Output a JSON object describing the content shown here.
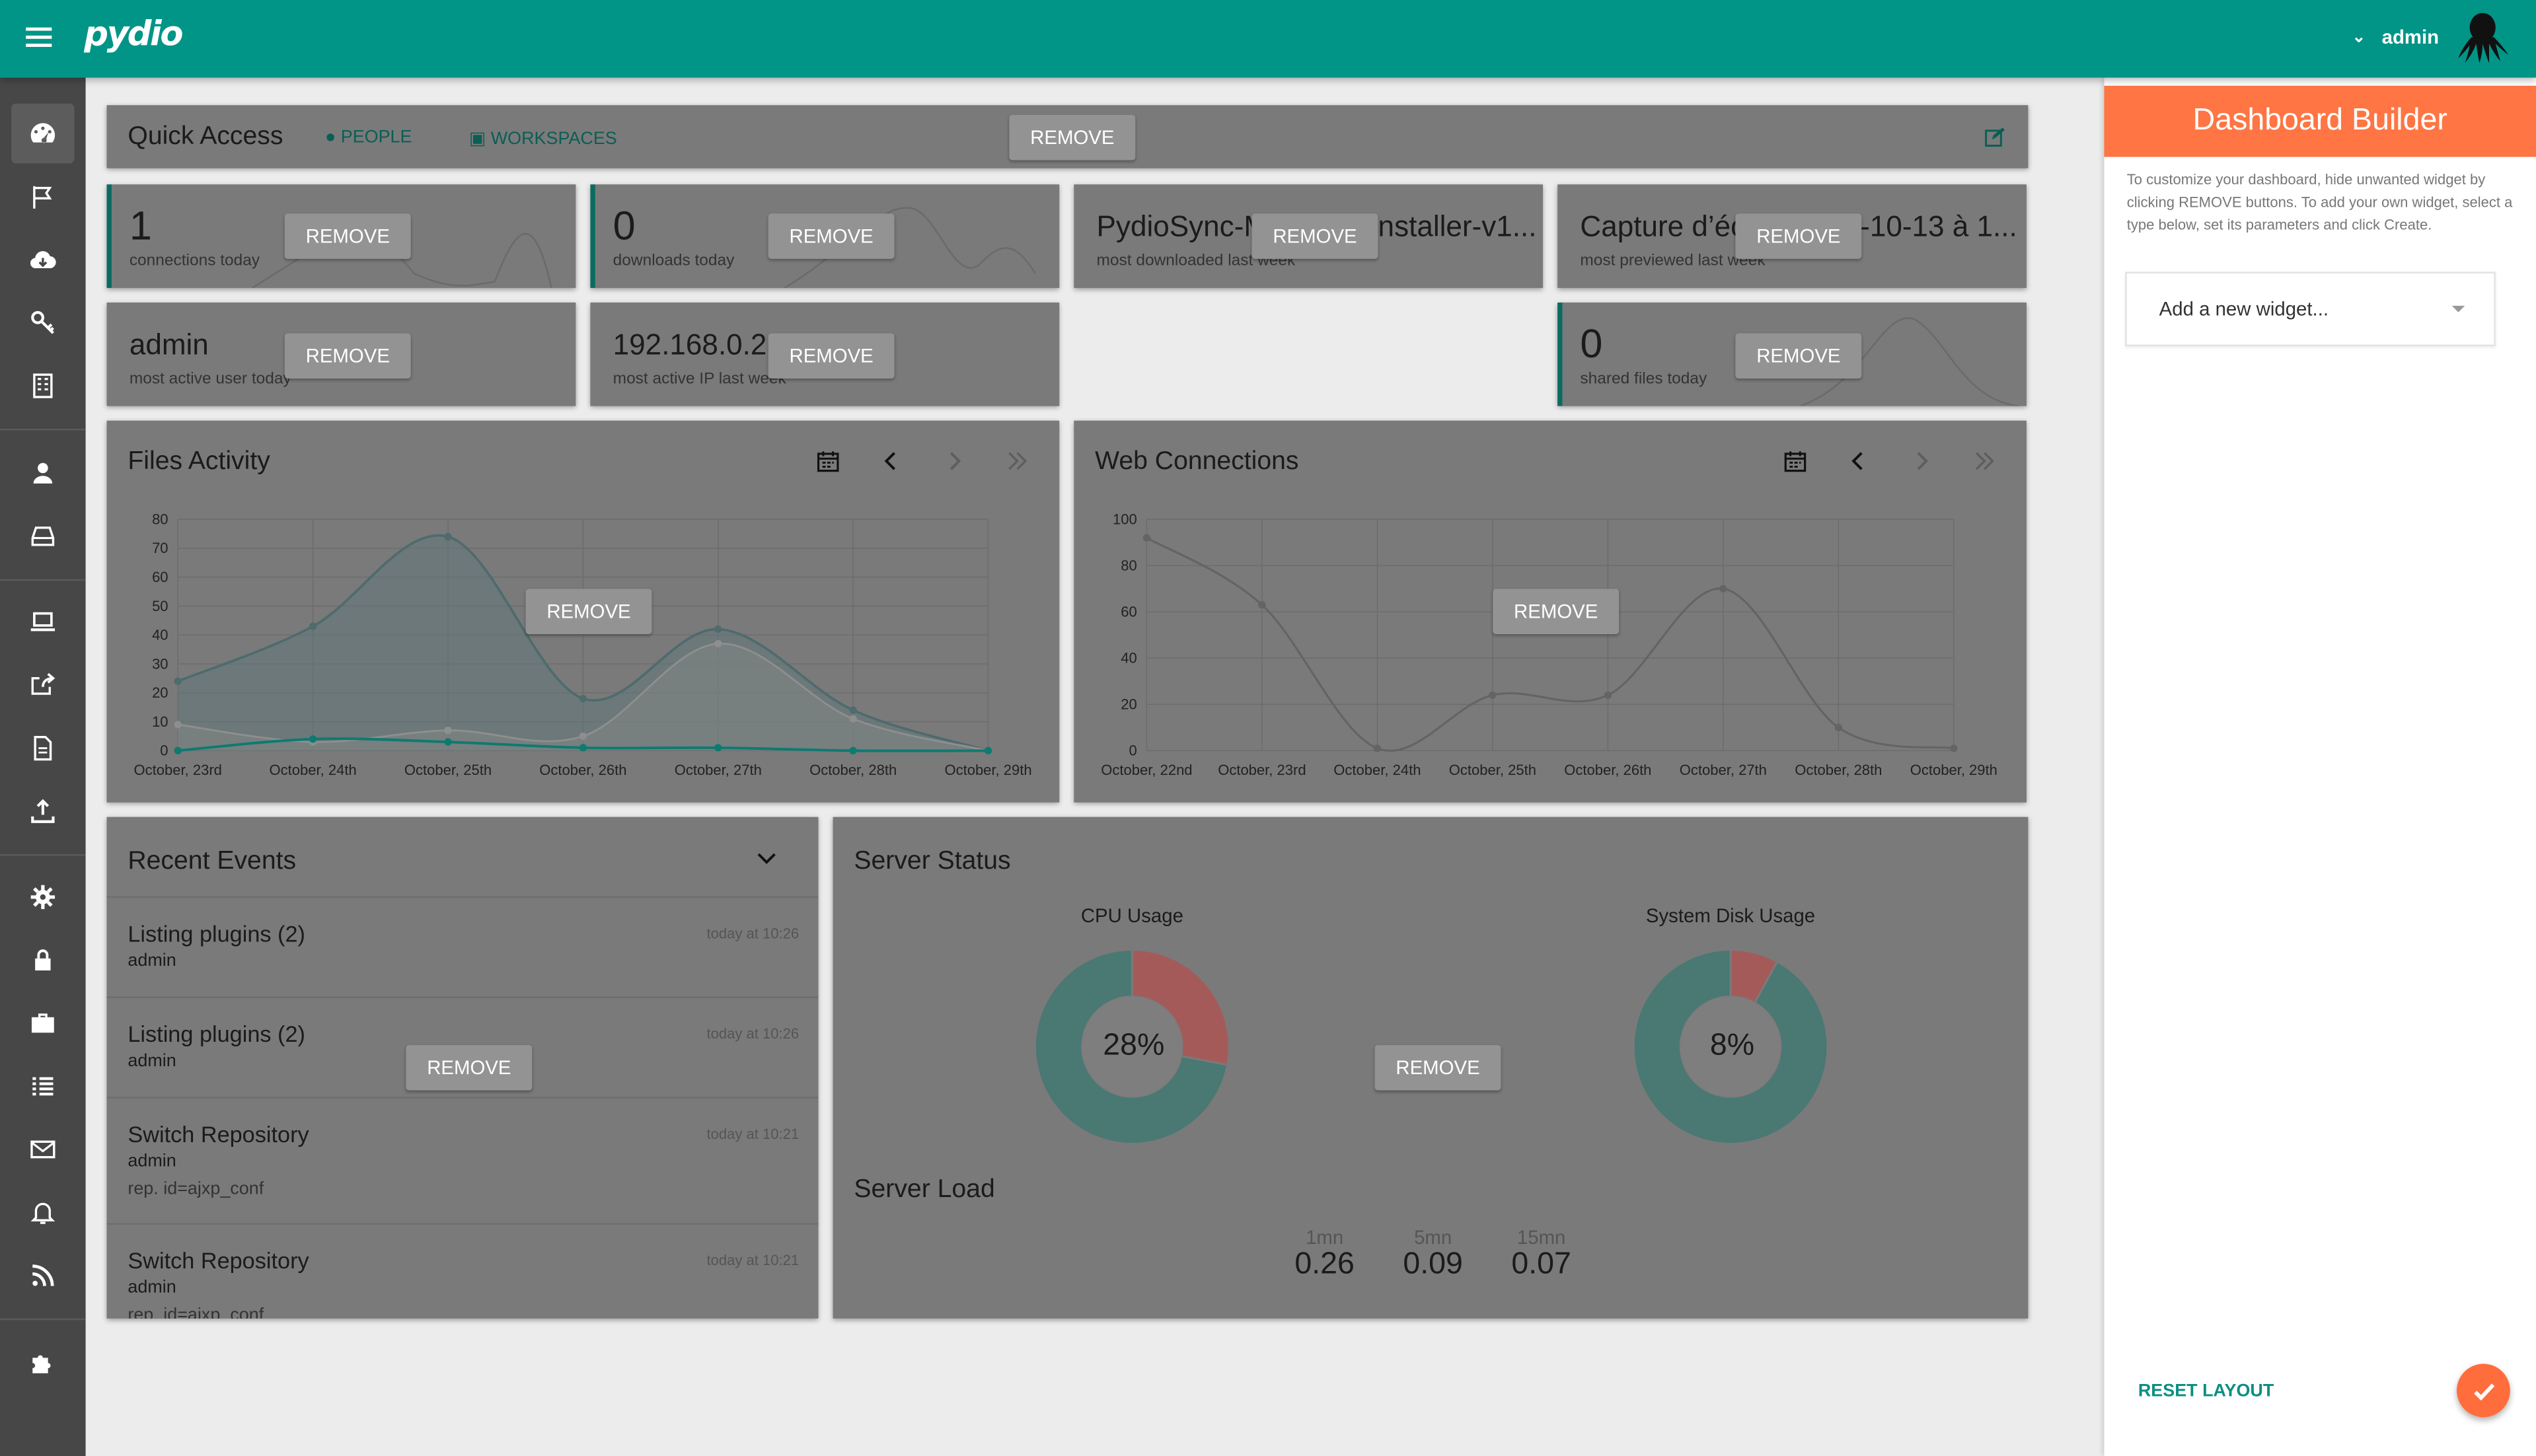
{
  "topbar": {
    "logo": "pydio",
    "username": "admin"
  },
  "sidebar": {
    "items": [
      {
        "icon": "dashboard-icon"
      },
      {
        "icon": "flag-icon"
      },
      {
        "icon": "cloud-download-icon"
      },
      {
        "icon": "key-icon"
      },
      {
        "icon": "building-icon"
      },
      {
        "icon": "user-icon"
      },
      {
        "icon": "drive-icon"
      },
      {
        "icon": "laptop-icon"
      },
      {
        "icon": "share-icon"
      },
      {
        "icon": "file-icon"
      },
      {
        "icon": "upload-icon"
      },
      {
        "icon": "gear-icon"
      },
      {
        "icon": "lock-icon"
      },
      {
        "icon": "briefcase-icon"
      },
      {
        "icon": "list-icon"
      },
      {
        "icon": "mail-icon"
      },
      {
        "icon": "bell-icon"
      },
      {
        "icon": "rss-icon"
      },
      {
        "icon": "puzzle-icon"
      }
    ]
  },
  "remove_label": "REMOVE",
  "quick_access": {
    "title": "Quick Access",
    "people": "PEOPLE",
    "workspaces": "WORKSPACES"
  },
  "stats": [
    {
      "value": "1",
      "label": "connections today"
    },
    {
      "value": "0",
      "label": "downloads today"
    },
    {
      "value": "PydioSync-MacOSX-Installer-v1...",
      "label": "most downloaded last week"
    },
    {
      "value": "Capture d’écran 2015-10-13 à 1...",
      "label": "most previewed last week"
    },
    {
      "value": "admin",
      "label": "most active user today"
    },
    {
      "value": "192.168.0.254",
      "label": "most active IP last week"
    },
    {
      "value": "0",
      "label": "shared files today"
    }
  ],
  "files_activity": {
    "title": "Files Activity"
  },
  "web_connections": {
    "title": "Web Connections"
  },
  "chart_data": [
    {
      "type": "area",
      "title": "Files Activity",
      "categories": [
        "October, 23rd",
        "October, 24th",
        "October, 25th",
        "October, 26th",
        "October, 27th",
        "October, 28th",
        "October, 29th"
      ],
      "ylim": [
        0,
        80
      ],
      "yticks": [
        0,
        10,
        20,
        30,
        40,
        50,
        60,
        70,
        80
      ],
      "series": [
        {
          "values": [
            24,
            43,
            74,
            18,
            42,
            14,
            0
          ]
        },
        {
          "values": [
            9,
            3,
            7,
            5,
            37,
            11,
            0
          ]
        },
        {
          "values": [
            0,
            4,
            3,
            1,
            1,
            0,
            0
          ]
        }
      ],
      "grid": true
    },
    {
      "type": "line",
      "title": "Web Connections",
      "categories": [
        "October, 22nd",
        "October, 23rd",
        "October, 24th",
        "October, 25th",
        "October, 26th",
        "October, 27th",
        "October, 28th",
        "October, 29th"
      ],
      "ylim": [
        0,
        100
      ],
      "yticks": [
        0,
        20,
        40,
        60,
        80,
        100
      ],
      "series": [
        {
          "values": [
            92,
            63,
            1,
            24,
            24,
            70,
            10,
            1
          ]
        }
      ],
      "grid": true
    },
    {
      "type": "pie",
      "title": "CPU Usage",
      "center_label": "28%",
      "values": [
        28,
        72
      ]
    },
    {
      "type": "pie",
      "title": "System Disk Usage",
      "center_label": "8%",
      "values": [
        8,
        92
      ]
    }
  ],
  "recent_events": {
    "title": "Recent Events",
    "items": [
      {
        "title": "Listing plugins (2)",
        "user": "admin",
        "extra": "",
        "time": "today at 10:26"
      },
      {
        "title": "Listing plugins (2)",
        "user": "admin",
        "extra": "",
        "time": "today at 10:26"
      },
      {
        "title": "Switch Repository",
        "user": "admin",
        "extra": "rep. id=ajxp_conf",
        "time": "today at 10:21"
      },
      {
        "title": "Switch Repository",
        "user": "admin",
        "extra": "rep. id=ajxp_conf",
        "time": "today at 10:21"
      }
    ]
  },
  "server_status": {
    "title": "Server Status",
    "cpu_label": "CPU Usage",
    "cpu_value": "28%",
    "disk_label": "System Disk Usage",
    "disk_value": "8%",
    "load_title": "Server Load",
    "loads": [
      {
        "label": "1mn",
        "value": "0.26"
      },
      {
        "label": "5mn",
        "value": "0.09"
      },
      {
        "label": "15mn",
        "value": "0.07"
      }
    ]
  },
  "builder": {
    "title": "Dashboard Builder",
    "help": "To customize your dashboard, hide unwanted widget by clicking REMOVE buttons. To add your own widget, select a type below, set its parameters and click Create.",
    "select_placeholder": "Add a new widget...",
    "reset_label": "RESET LAYOUT"
  },
  "colors": {
    "primary": "#009587",
    "accent": "#ff7543",
    "cpu_used": "#a55a5a",
    "free": "#4a7873"
  }
}
